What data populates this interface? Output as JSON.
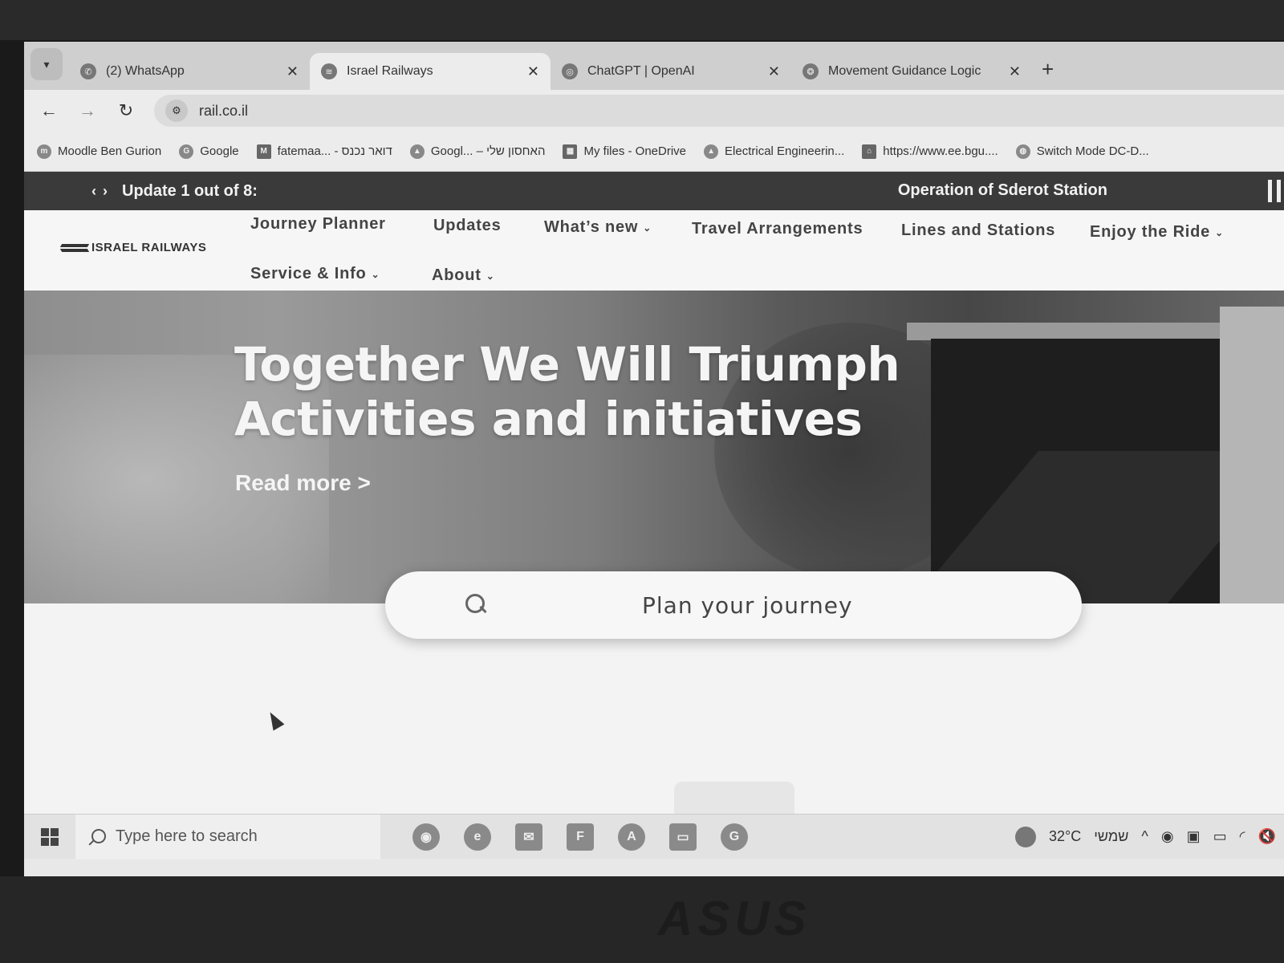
{
  "browser": {
    "tabs": [
      {
        "title": "(2) WhatsApp",
        "icon": "whatsapp-icon",
        "active": false
      },
      {
        "title": "Israel Railways",
        "icon": "israel-railways-icon",
        "active": true
      },
      {
        "title": "ChatGPT | OpenAI",
        "icon": "chatgpt-icon",
        "active": false
      },
      {
        "title": "Movement Guidance Logic",
        "icon": "openai-icon",
        "active": false
      }
    ],
    "new_tab_label": "+",
    "url": "rail.co.il",
    "bookmarks": [
      {
        "label": "Moodle Ben Gurion",
        "icon": "moodle-icon"
      },
      {
        "label": "Google",
        "icon": "google-icon"
      },
      {
        "label": "fatemaa... - דואר נכנס",
        "icon": "gmail-icon"
      },
      {
        "label": "Googl... – האחסון שלי",
        "icon": "google-drive-icon"
      },
      {
        "label": "My files - OneDrive",
        "icon": "onedrive-icon"
      },
      {
        "label": "Electrical Engineerin...",
        "icon": "google-drive-icon"
      },
      {
        "label": "https://www.ee.bgu....",
        "icon": "bgu-icon"
      },
      {
        "label": "Switch Mode DC-D...",
        "icon": "globe-icon"
      }
    ]
  },
  "ticker": {
    "counter": "Update 1 out of 8:",
    "headline": "Operation of Sderot Station"
  },
  "site": {
    "logo": "ISRAEL RAILWAYS",
    "nav": {
      "journey_planner": "Journey Planner",
      "updates": "Updates",
      "whats_new": "What’s new",
      "travel_arrangements": "Travel Arrangements",
      "lines_and_stations": "Lines and Stations",
      "enjoy_the_ride": "Enjoy the Ride",
      "service_info": "Service & Info",
      "about": "About"
    }
  },
  "hero": {
    "title_line1": "Together We Will Triumph",
    "title_line2": "Activities and initiatives",
    "read_more": "Read more >"
  },
  "search": {
    "placeholder": "Plan your journey"
  },
  "taskbar": {
    "search_placeholder": "Type here to search",
    "temperature": "32°C",
    "weather_text": "שמשי",
    "apps": [
      "chrome-icon",
      "edge-icon",
      "mail-icon",
      "files-icon",
      "store-icon",
      "explorer-icon",
      "grammarly-icon"
    ]
  },
  "brand": "ASUS"
}
